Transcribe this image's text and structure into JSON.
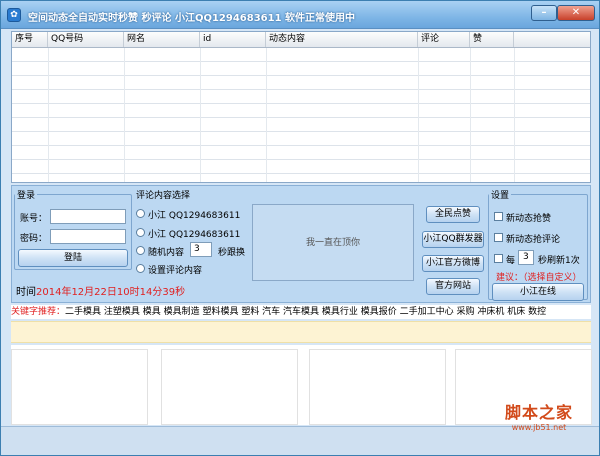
{
  "window": {
    "title": "空间动态全自动实时秒赞 秒评论   小江QQ1294683611   软件正常使用中",
    "min_label": "–",
    "close_label": "✕"
  },
  "table": {
    "columns": [
      "序号",
      "QQ号码",
      "网名",
      "id",
      "动态内容",
      "评论",
      "赞"
    ]
  },
  "login": {
    "legend": "登录",
    "account_label": "账号：",
    "account_value": "",
    "password_label": "密码：",
    "password_value": "",
    "login_button": "登陆"
  },
  "comment": {
    "legend": "评论内容选择",
    "opt1": "小江 QQ1294683611",
    "opt2": "小江 QQ1294683611",
    "opt3_prefix": "随机内容",
    "opt3_value": "3",
    "opt3_suffix": "秒跟换",
    "opt4": "设置评论内容"
  },
  "message_box": {
    "text": "我一直在顶你"
  },
  "actions": {
    "all_like": "全民点赞",
    "qq_group": "小江QQ群发器",
    "official_weibo": "小江官方微博",
    "official_site": "官方网站"
  },
  "settings": {
    "legend": "设置",
    "dynamic_like": "新动态抢赞",
    "dynamic_comment": "新动态抢评论",
    "refresh_prefix": "每",
    "refresh_value": "3",
    "refresh_suffix": "秒刷新1次",
    "suggest": "建议：（选择自定义）",
    "online_button": "小江在线"
  },
  "time": {
    "label": "时间",
    "value": "2014年12月22日10时14分39秒"
  },
  "ticker": {
    "prefix": "关键字推荐：",
    "text": "二手模具 注塑模具 模具 模具制造 塑料模具 塑料 汽车 汽车模具 模具行业 模具报价 二手加工中心 采购 冲床机 机床 数控"
  },
  "watermark": {
    "big": "脚本之家",
    "small": "www.jb51.net"
  }
}
